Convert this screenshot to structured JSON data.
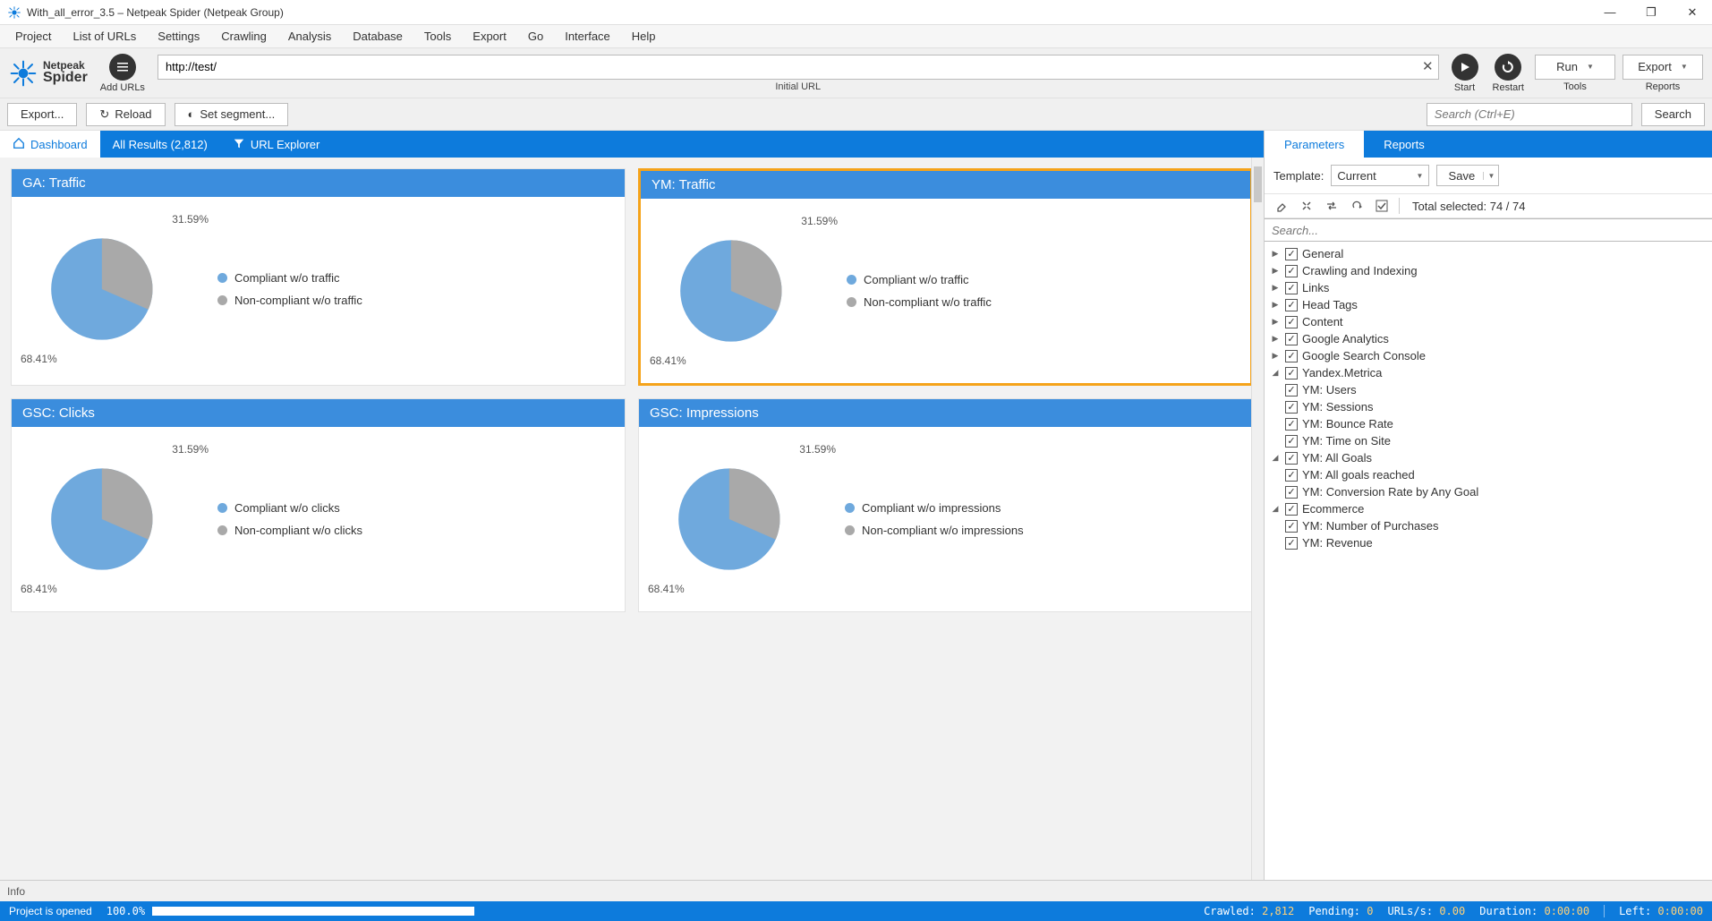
{
  "window": {
    "title": "With_all_error_3.5 – Netpeak Spider (Netpeak Group)"
  },
  "menu": [
    "Project",
    "List of URLs",
    "Settings",
    "Crawling",
    "Analysis",
    "Database",
    "Tools",
    "Export",
    "Go",
    "Interface",
    "Help"
  ],
  "brand": {
    "l1": "Netpeak",
    "l2": "Spider"
  },
  "toolbar": {
    "add_urls": "Add URLs",
    "url_value": "http://test/",
    "url_sublabel": "Initial URL",
    "start": "Start",
    "restart": "Restart",
    "run": "Run",
    "run_sub": "Tools",
    "export": "Export",
    "export_sub": "Reports"
  },
  "toolbar2": {
    "export": "Export...",
    "reload": "Reload",
    "segment": "Set segment...",
    "search_ph": "Search (Ctrl+E)",
    "search_btn": "Search"
  },
  "tabs": {
    "dashboard": "Dashboard",
    "all_results": "All Results (2,812)",
    "url_explorer": "URL Explorer"
  },
  "colors": {
    "slice_a": "#6fa9dd",
    "slice_b": "#a9a9a9"
  },
  "cards": [
    {
      "title": "GA: Traffic",
      "highlight": false,
      "legend": [
        "Compliant w/o traffic",
        "Non-compliant w/o traffic"
      ]
    },
    {
      "title": "YM: Traffic",
      "highlight": true,
      "legend": [
        "Compliant w/o traffic",
        "Non-compliant w/o traffic"
      ]
    },
    {
      "title": "GSC: Clicks",
      "highlight": false,
      "legend": [
        "Compliant w/o clicks",
        "Non-compliant w/o clicks"
      ]
    },
    {
      "title": "GSC: Impressions",
      "highlight": false,
      "legend": [
        "Compliant w/o impressions",
        "Non-compliant w/o impressions"
      ]
    }
  ],
  "chart_data": [
    {
      "type": "pie",
      "title": "GA: Traffic",
      "categories": [
        "Compliant w/o traffic",
        "Non-compliant w/o traffic"
      ],
      "values": [
        68.41,
        31.59
      ],
      "labels": [
        "68.41%",
        "31.59%"
      ]
    },
    {
      "type": "pie",
      "title": "YM: Traffic",
      "categories": [
        "Compliant w/o traffic",
        "Non-compliant w/o traffic"
      ],
      "values": [
        68.41,
        31.59
      ],
      "labels": [
        "68.41%",
        "31.59%"
      ]
    },
    {
      "type": "pie",
      "title": "GSC: Clicks",
      "categories": [
        "Compliant w/o clicks",
        "Non-compliant w/o clicks"
      ],
      "values": [
        68.41,
        31.59
      ],
      "labels": [
        "68.41%",
        "31.59%"
      ]
    },
    {
      "type": "pie",
      "title": "GSC: Impressions",
      "categories": [
        "Compliant w/o impressions",
        "Non-compliant w/o impressions"
      ],
      "values": [
        68.41,
        31.59
      ],
      "labels": [
        "68.41%",
        "31.59%"
      ]
    }
  ],
  "right": {
    "tabs": {
      "parameters": "Parameters",
      "reports": "Reports"
    },
    "template_label": "Template:",
    "template_value": "Current",
    "save": "Save",
    "total_selected": "Total selected: 74 / 74",
    "search_ph": "Search...",
    "tree": [
      {
        "level": 1,
        "arrow": "▶",
        "checked": true,
        "label": "General"
      },
      {
        "level": 1,
        "arrow": "▶",
        "checked": true,
        "label": "Crawling and Indexing"
      },
      {
        "level": 1,
        "arrow": "▶",
        "checked": true,
        "label": "Links"
      },
      {
        "level": 1,
        "arrow": "▶",
        "checked": true,
        "label": "Head Tags"
      },
      {
        "level": 1,
        "arrow": "▶",
        "checked": true,
        "label": "Content"
      },
      {
        "level": 1,
        "arrow": "▶",
        "checked": true,
        "label": "Google Analytics"
      },
      {
        "level": 1,
        "arrow": "▶",
        "checked": true,
        "label": "Google Search Console"
      },
      {
        "level": 1,
        "arrow": "◢",
        "checked": true,
        "label": "Yandex.Metrica"
      },
      {
        "level": 2,
        "arrow": "",
        "checked": true,
        "label": "YM: Users"
      },
      {
        "level": 2,
        "arrow": "",
        "checked": true,
        "label": "YM: Sessions"
      },
      {
        "level": 2,
        "arrow": "",
        "checked": true,
        "label": "YM: Bounce Rate"
      },
      {
        "level": 2,
        "arrow": "",
        "checked": true,
        "label": "YM: Time on Site"
      },
      {
        "level": 2,
        "arrow": "◢",
        "checked": true,
        "label": "YM: All Goals"
      },
      {
        "level": 3,
        "arrow": "",
        "checked": true,
        "label": "YM: All goals reached"
      },
      {
        "level": 3,
        "arrow": "",
        "checked": true,
        "label": "YM: Conversion Rate by Any Goal"
      },
      {
        "level": 2,
        "arrow": "◢",
        "checked": true,
        "label": "Ecommerce"
      },
      {
        "level": 3,
        "arrow": "",
        "checked": true,
        "label": "YM: Number of Purchases"
      },
      {
        "level": 3,
        "arrow": "",
        "checked": true,
        "label": "YM: Revenue"
      }
    ]
  },
  "infobar": "Info",
  "status": {
    "project": "Project is opened",
    "progress_pct": "100.0%",
    "progress_val": 100,
    "crawled_k": "Crawled:",
    "crawled_v": "2,812",
    "pending_k": "Pending:",
    "pending_v": "0",
    "urls_k": "URLs/s:",
    "urls_v": "0.00",
    "duration_k": "Duration:",
    "duration_v": "0:00:00",
    "left_k": "Left:",
    "left_v": "0:00:00"
  }
}
